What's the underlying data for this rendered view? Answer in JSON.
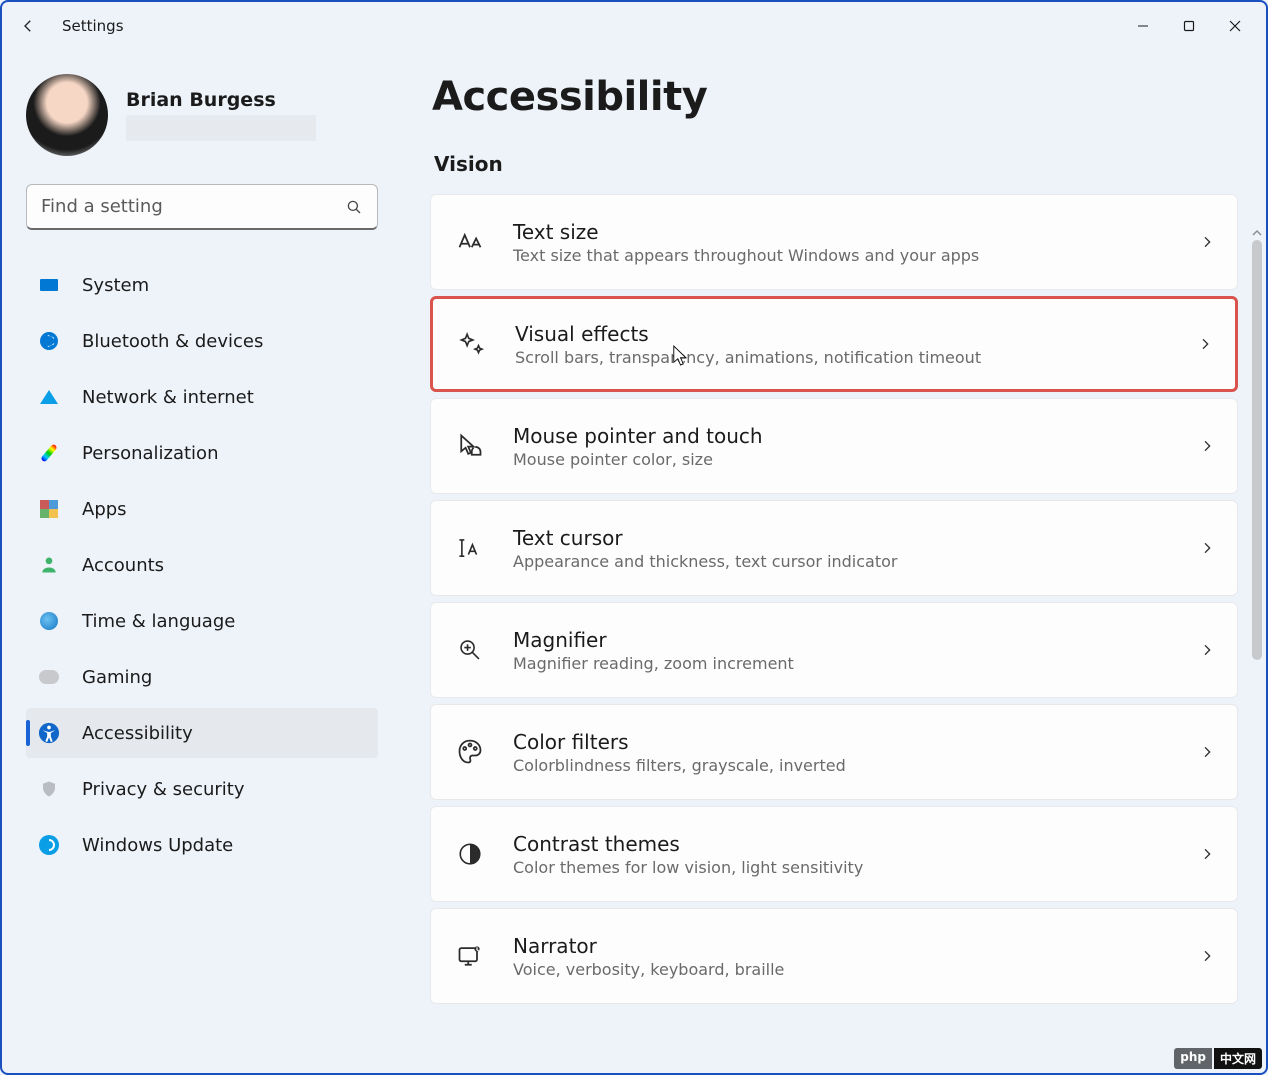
{
  "app": {
    "title": "Settings"
  },
  "profile": {
    "name": "Brian Burgess"
  },
  "search": {
    "placeholder": "Find a setting"
  },
  "sidebar": {
    "items": [
      {
        "label": "System",
        "selected": false,
        "icon": "system"
      },
      {
        "label": "Bluetooth & devices",
        "selected": false,
        "icon": "bt"
      },
      {
        "label": "Network & internet",
        "selected": false,
        "icon": "net"
      },
      {
        "label": "Personalization",
        "selected": false,
        "icon": "pers"
      },
      {
        "label": "Apps",
        "selected": false,
        "icon": "apps"
      },
      {
        "label": "Accounts",
        "selected": false,
        "icon": "acc"
      },
      {
        "label": "Time & language",
        "selected": false,
        "icon": "time"
      },
      {
        "label": "Gaming",
        "selected": false,
        "icon": "game"
      },
      {
        "label": "Accessibility",
        "selected": true,
        "icon": "accessibility"
      },
      {
        "label": "Privacy & security",
        "selected": false,
        "icon": "priv"
      },
      {
        "label": "Windows Update",
        "selected": false,
        "icon": "upd"
      }
    ]
  },
  "page": {
    "title": "Accessibility",
    "section": "Vision"
  },
  "cards": [
    {
      "id": "text-size",
      "title": "Text size",
      "subtitle": "Text size that appears throughout Windows and your apps",
      "highlight": false
    },
    {
      "id": "visual-effects",
      "title": "Visual effects",
      "subtitle": "Scroll bars, transparency, animations, notification timeout",
      "highlight": true
    },
    {
      "id": "mouse-pointer",
      "title": "Mouse pointer and touch",
      "subtitle": "Mouse pointer color, size",
      "highlight": false
    },
    {
      "id": "text-cursor",
      "title": "Text cursor",
      "subtitle": "Appearance and thickness, text cursor indicator",
      "highlight": false
    },
    {
      "id": "magnifier",
      "title": "Magnifier",
      "subtitle": "Magnifier reading, zoom increment",
      "highlight": false
    },
    {
      "id": "color-filters",
      "title": "Color filters",
      "subtitle": "Colorblindness filters, grayscale, inverted",
      "highlight": false
    },
    {
      "id": "contrast-themes",
      "title": "Contrast themes",
      "subtitle": "Color themes for low vision, light sensitivity",
      "highlight": false
    },
    {
      "id": "narrator",
      "title": "Narrator",
      "subtitle": "Voice, verbosity, keyboard, braille",
      "highlight": false
    }
  ],
  "watermark": {
    "left": "php",
    "right": "中文网"
  }
}
